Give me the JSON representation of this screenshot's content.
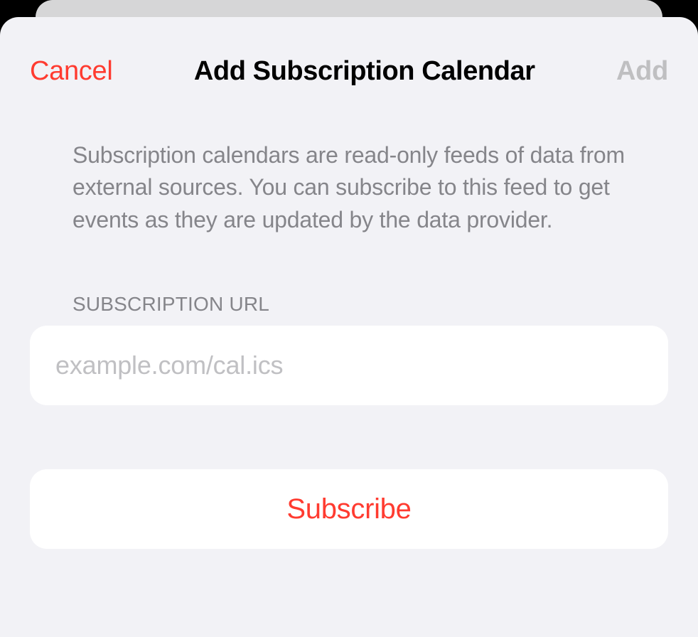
{
  "nav": {
    "cancel_label": "Cancel",
    "title": "Add Subscription Calendar",
    "add_label": "Add"
  },
  "description": "Subscription calendars are read-only feeds of data from external sources. You can subscribe to this feed to get events as they are updated by the data provider.",
  "url_section": {
    "label": "SUBSCRIPTION URL",
    "placeholder": "example.com/cal.ics",
    "value": ""
  },
  "subscribe_label": "Subscribe",
  "colors": {
    "accent": "#ff3b30",
    "sheet_bg": "#f2f2f6",
    "cell_bg": "#ffffff",
    "secondary_text": "#85858a",
    "disabled_text": "#bfbfc1"
  }
}
